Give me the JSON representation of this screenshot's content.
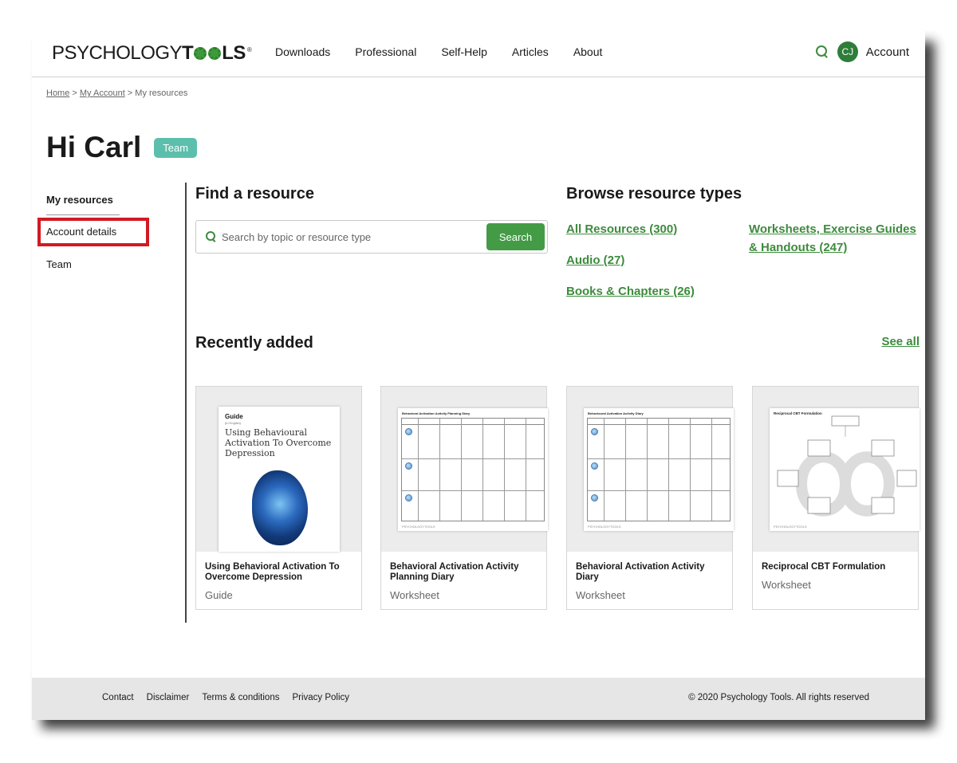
{
  "header": {
    "logo_left": "PSYCHOLOGY",
    "logo_t": "T",
    "logo_ls": "LS",
    "logo_reg": "®",
    "nav": [
      "Downloads",
      "Professional",
      "Self-Help",
      "Articles",
      "About"
    ],
    "avatar_initials": "CJ",
    "account_label": "Account"
  },
  "breadcrumb": {
    "home": "Home",
    "sep": " > ",
    "my_account": "My Account",
    "current": "My resources"
  },
  "greeting": {
    "title": "Hi Carl",
    "badge": "Team"
  },
  "sidebar": {
    "items": [
      "My resources",
      "Account details",
      "Team"
    ]
  },
  "find": {
    "title": "Find a resource",
    "placeholder": "Search by topic or resource type",
    "button": "Search"
  },
  "browse": {
    "title": "Browse resource types",
    "links": [
      "All Resources (300)",
      "Audio (27)",
      "Books & Chapters (26)",
      "Worksheets, Exercise Guides",
      "& Handouts (247)"
    ]
  },
  "recent": {
    "title": "Recently added",
    "see_all": "See all",
    "cards": [
      {
        "title_line1": "Using Behavioral Activation To",
        "title_line2": "Overcome Depression",
        "type": "Guide"
      },
      {
        "title_line1": "Behavioral Activation Activity",
        "title_line2": "Planning Diary",
        "type": "Worksheet"
      },
      {
        "title_line1": "Behavioral Activation Activity",
        "title_line2": "Diary",
        "type": "Worksheet"
      },
      {
        "title_line1": "Reciprocal CBT Formulation",
        "title_line2": "",
        "type": "Worksheet"
      }
    ],
    "thumb_guide": {
      "label": "Guide",
      "sub": "(in English)",
      "title": "Using Behavioural Activation To Overcome Depression"
    },
    "thumb_planning_title": "Behavioral Activation Activity Planning Diary",
    "thumb_diary_title": "Behavioural Activation Activity Diary",
    "thumb_cbt_title": "Reciprocal CBT Formulation",
    "thumb_footer": "PSYCHOLOGYTOOLS"
  },
  "footer": {
    "links": [
      "Contact",
      "Disclaimer",
      "Terms & conditions",
      "Privacy Policy"
    ],
    "copyright": "© 2020 Psychology Tools. All rights reserved"
  },
  "colors": {
    "accent_green": "#3d8b3d",
    "button_green": "#449b46",
    "badge_teal": "#5cbfac",
    "highlight_red": "#d11a24"
  }
}
